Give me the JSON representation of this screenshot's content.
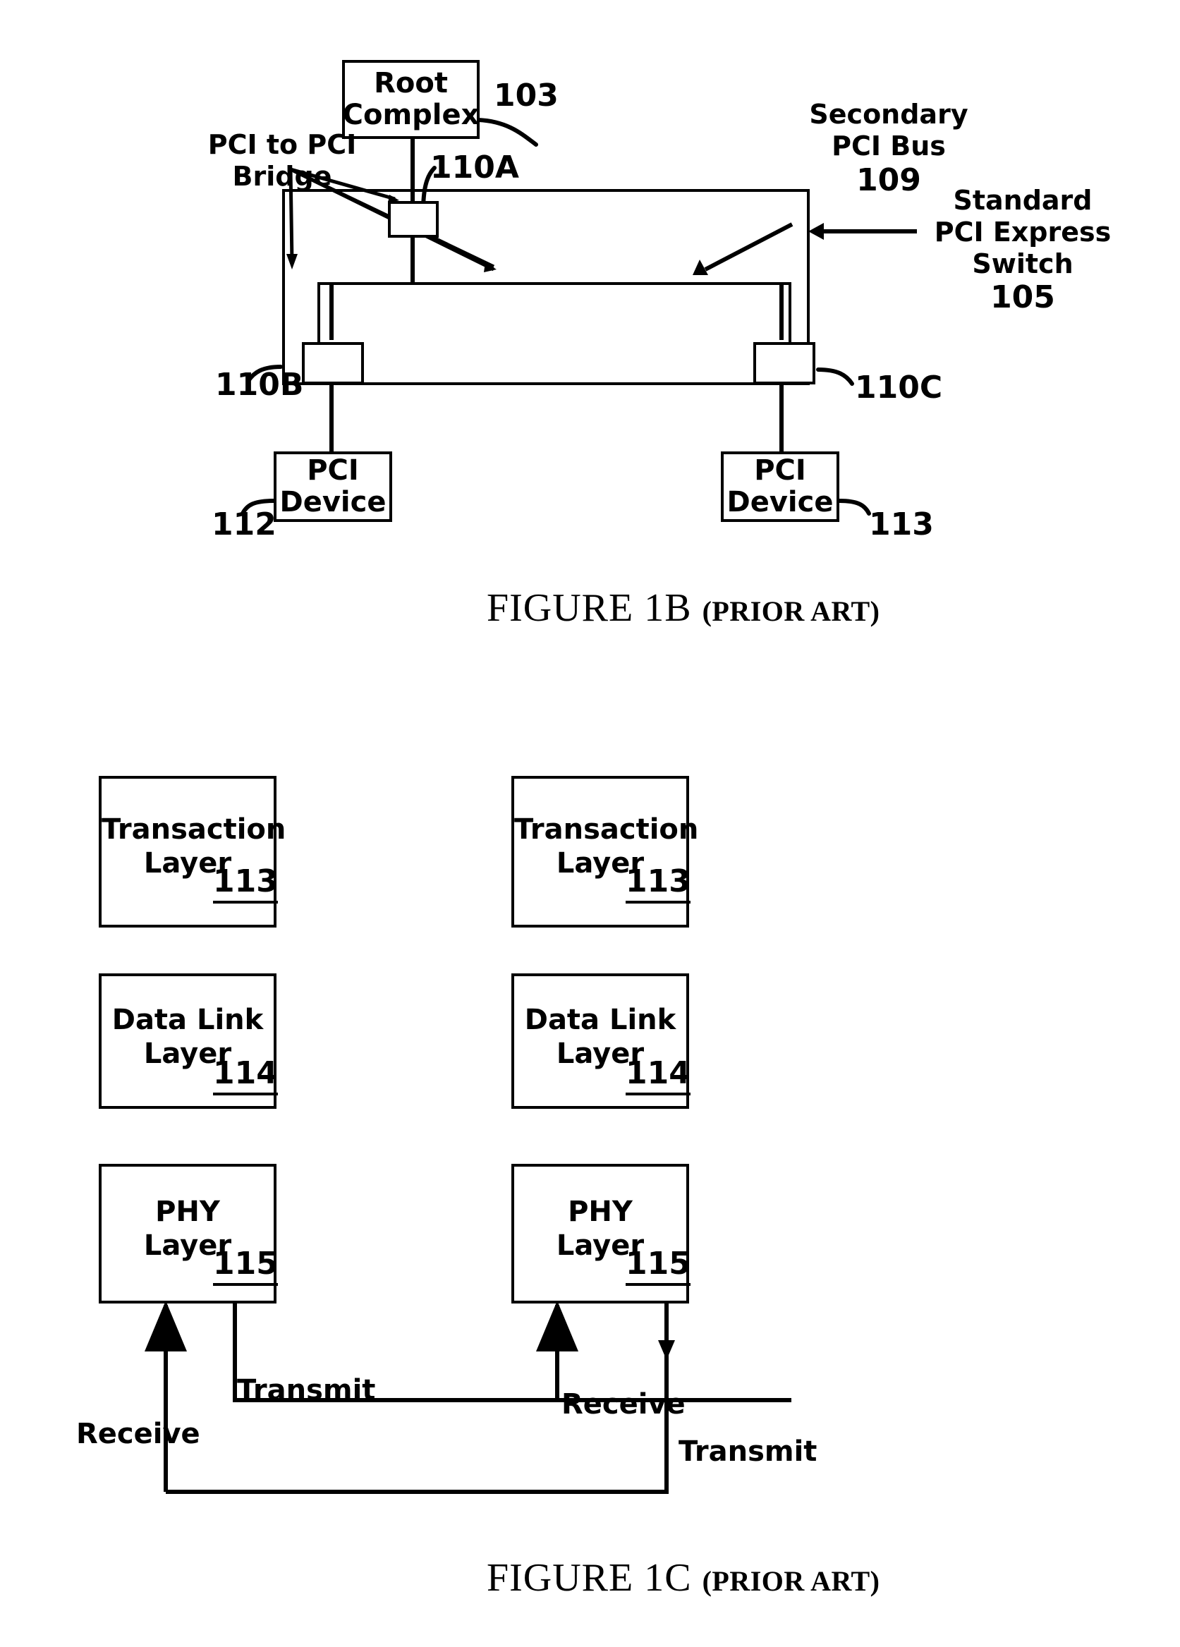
{
  "document": {
    "type": "patent-figure-sheet",
    "figures": [
      "FIGURE 1B (PRIOR ART)",
      "FIGURE 1C (PRIOR ART)"
    ]
  },
  "figure_1b": {
    "caption": "FIGURE 1B",
    "caption_suffix": "(PRIOR ART)",
    "root_complex": {
      "line1": "Root",
      "line2": "Complex",
      "ref": "103"
    },
    "annotations": {
      "bridge_line1": "PCI to PCI",
      "bridge_line2": "Bridge",
      "secondary_line1": "Secondary",
      "secondary_line2": "PCI Bus",
      "secondary_ref": "109",
      "switch_line1": "Standard",
      "switch_line2": "PCI Express",
      "switch_line3": "Switch",
      "switch_ref": "105"
    },
    "ports": {
      "upstream": "110A",
      "downstream_left": "110B",
      "downstream_right": "110C"
    },
    "devices": [
      {
        "line1": "PCI",
        "line2": "Device",
        "ref": "112"
      },
      {
        "line1": "PCI",
        "line2": "Device",
        "ref": "113"
      }
    ]
  },
  "figure_1c": {
    "caption": "FIGURE 1C",
    "caption_suffix": "(PRIOR ART)",
    "stacks": [
      {
        "side": "left",
        "layers": [
          {
            "line1": "Transaction",
            "line2": "Layer",
            "ref": "113"
          },
          {
            "line1": "Data Link",
            "line2": "Layer",
            "ref": "114"
          },
          {
            "line1": "PHY",
            "line2": "Layer",
            "ref": "115"
          }
        ],
        "receive_label": "Receive",
        "transmit_label": "Transmit"
      },
      {
        "side": "right",
        "layers": [
          {
            "line1": "Transaction",
            "line2": "Layer",
            "ref": "113"
          },
          {
            "line1": "Data Link",
            "line2": "Layer",
            "ref": "114"
          },
          {
            "line1": "PHY",
            "line2": "Layer",
            "ref": "115"
          }
        ],
        "receive_label": "Receive",
        "transmit_label": "Transmit"
      }
    ]
  },
  "colors": {
    "ink": "#000000",
    "paper": "#ffffff"
  }
}
